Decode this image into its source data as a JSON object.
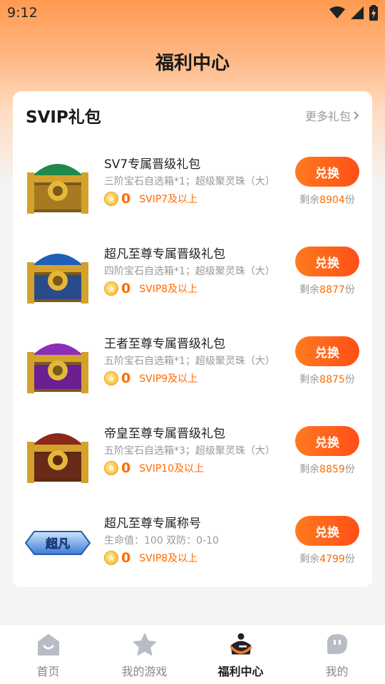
{
  "status": {
    "time": "9:12"
  },
  "header": {
    "title": "福利中心"
  },
  "section": {
    "title": "SVIP礼包",
    "more_label": "更多礼包"
  },
  "items": [
    {
      "name": "SV7专属晋级礼包",
      "desc": "三阶宝石自选箱*1；超级聚灵珠（大）",
      "price": "0",
      "requirement": "SVIP7及以上",
      "button": "兑换",
      "remain_prefix": "剩余",
      "remain_count": "8904",
      "remain_suffix": "份",
      "chest_color": "#1e8a4a"
    },
    {
      "name": "超凡至尊专属晋级礼包",
      "desc": "四阶宝石自选箱*1；超级聚灵珠（大）",
      "price": "0",
      "requirement": "SVIP8及以上",
      "button": "兑换",
      "remain_prefix": "剩余",
      "remain_count": "8877",
      "remain_suffix": "份",
      "chest_color": "#1f5fb8"
    },
    {
      "name": "王者至尊专属晋级礼包",
      "desc": "五阶宝石自选箱*1；超级聚灵珠（大）",
      "price": "0",
      "requirement": "SVIP9及以上",
      "button": "兑换",
      "remain_prefix": "剩余",
      "remain_count": "8875",
      "remain_suffix": "份",
      "chest_color": "#8a2fb8"
    },
    {
      "name": "帝皇至尊专属晋级礼包",
      "desc": "五阶宝石自选箱*3；超级聚灵珠（大）",
      "price": "0",
      "requirement": "SVIP10及以上",
      "button": "兑换",
      "remain_prefix": "剩余",
      "remain_count": "8859",
      "remain_suffix": "份",
      "chest_color": "#8a2a1a"
    },
    {
      "name": "超凡至尊专属称号",
      "desc": "生命值：100 双防：0-10",
      "price": "0",
      "requirement": "SVIP8及以上",
      "button": "兑换",
      "remain_prefix": "剩余",
      "remain_count": "4799",
      "remain_suffix": "份",
      "badge_text": "超凡"
    }
  ],
  "tabs": [
    {
      "label": "首页",
      "icon": "home-icon"
    },
    {
      "label": "我的游戏",
      "icon": "star-icon"
    },
    {
      "label": "福利中心",
      "icon": "welfare-icon",
      "active": true
    },
    {
      "label": "我的",
      "icon": "profile-icon"
    }
  ],
  "colors": {
    "accent": "#ff6a00",
    "button_start": "#ff7a1f",
    "button_end": "#ff4f17"
  }
}
